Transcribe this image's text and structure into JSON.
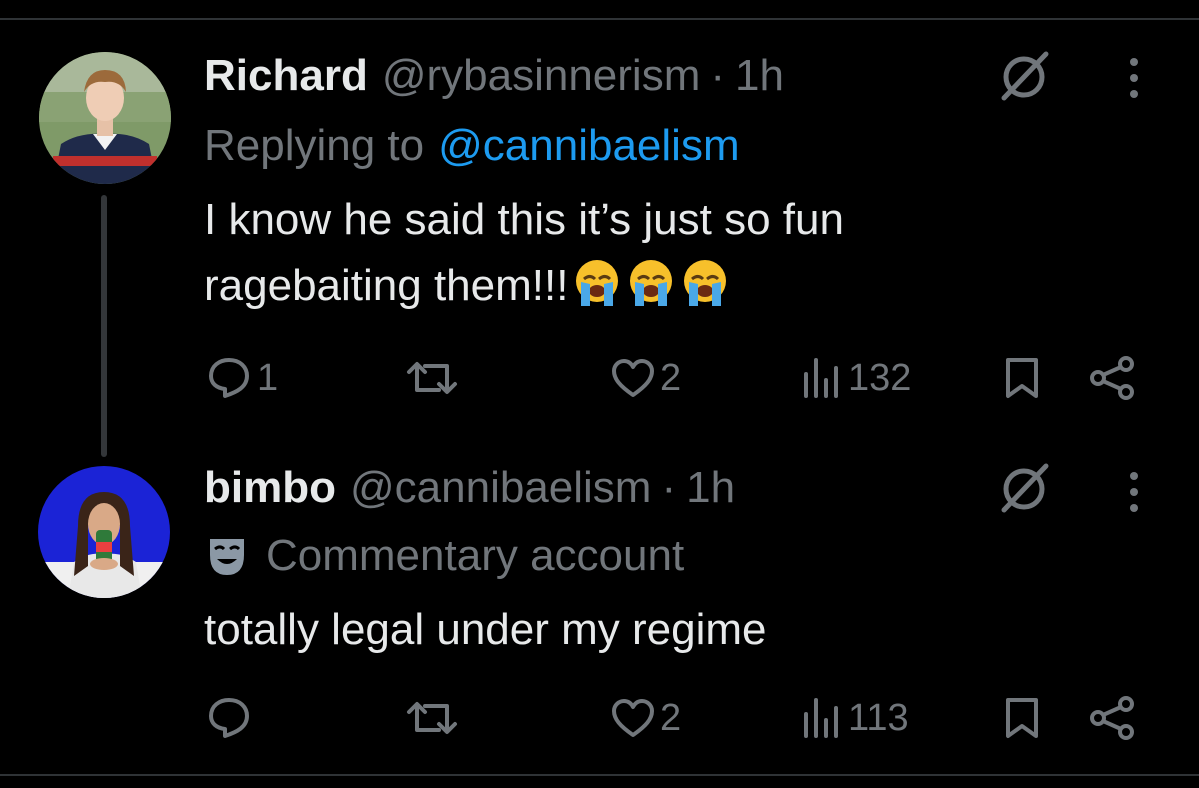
{
  "tweets": [
    {
      "name": "Richard",
      "handle": "@rybasinnerism",
      "separator": "·",
      "time": "1h",
      "replying_prefix": "Replying to",
      "replying_to": "@cannibaelism",
      "text_line1": "I know he said this it’s just so fun",
      "text_line2": "ragebaiting them!!!",
      "emojis": [
        "loudly-crying-face",
        "loudly-crying-face",
        "loudly-crying-face"
      ],
      "replies": "1",
      "retweets": "",
      "likes": "2",
      "views": "132"
    },
    {
      "name": "bimbo",
      "handle": "@cannibaelism",
      "separator": "·",
      "time": "1h",
      "badge_icon": "theater-mask-icon",
      "badge_text": "Commentary account",
      "text_line1": "totally legal under my regime",
      "replies": "",
      "retweets": "",
      "likes": "2",
      "views": "113"
    }
  ],
  "colors": {
    "background": "#000000",
    "text_primary": "#e7e9ea",
    "text_secondary": "#71767b",
    "link": "#1d9bf0",
    "divider": "#2f3336",
    "thread_line": "#333639"
  }
}
